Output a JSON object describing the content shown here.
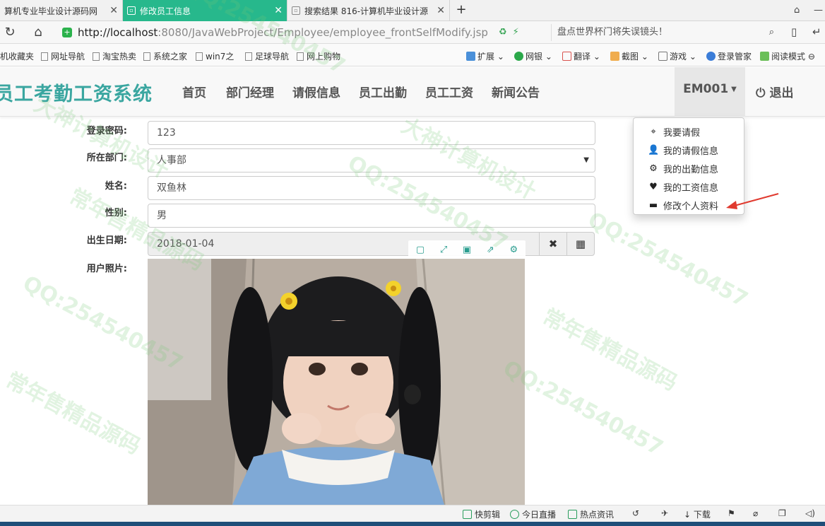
{
  "browser": {
    "tabs": [
      {
        "title": "算机专业毕业设计源码网",
        "active": false
      },
      {
        "title": "修改员工信息",
        "active": true
      },
      {
        "title": "搜索结果 816-计算机毕业设计源",
        "active": false
      }
    ],
    "new_tab": "+",
    "url": {
      "host": "http://localhost",
      "rest": ":8080/JavaWebProject/Employee/employee_frontSelfModify.jsp"
    },
    "search_placeholder": "盘点世界杯门将失误镜头！",
    "bookmarks": [
      "机收藏夹",
      "网址导航",
      "淘宝热卖",
      "系统之家",
      "win7之",
      "足球导航",
      "网上购物"
    ],
    "toolbar_right": [
      "扩展",
      "网银",
      "翻译",
      "截图",
      "游戏",
      "登录管家",
      "阅读模式"
    ]
  },
  "app": {
    "brand": "员工考勤工资系统",
    "nav": [
      "首页",
      "部门经理",
      "请假信息",
      "员工出勤",
      "员工工资",
      "新闻公告"
    ],
    "user": "EM001",
    "logout": "退出",
    "dropdown": [
      {
        "label": "我要请假",
        "icon": "crosshair-icon"
      },
      {
        "label": "我的请假信息",
        "icon": "user-icon"
      },
      {
        "label": "我的出勤信息",
        "icon": "gear-icon"
      },
      {
        "label": "我的工资信息",
        "icon": "heart-icon"
      },
      {
        "label": "修改个人资料",
        "icon": "card-icon"
      }
    ]
  },
  "form": {
    "password_label": "登录密码:",
    "password_value": "123",
    "department_label": "所在部门:",
    "department_value": "人事部",
    "name_label": "姓名:",
    "name_value": "双鱼林",
    "gender_label": "性别:",
    "gender_value": "男",
    "birth_label": "出生日期:",
    "birth_value": "2018-01-04",
    "photo_label": "用户照片:"
  },
  "statusbar": [
    "快剪辑",
    "今日直播",
    "热点资讯",
    "下载"
  ],
  "watermarks": [
    "QQ:254540457",
    "大神计算机设计",
    "常年售精品源码"
  ],
  "colors": {
    "accent": "#27b88c",
    "brand": "#3aa6a0"
  }
}
